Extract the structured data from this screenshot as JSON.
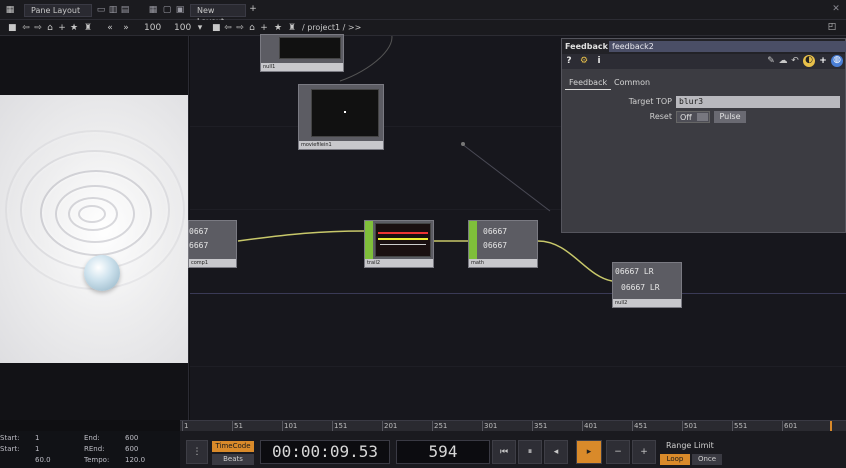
{
  "topbar": {
    "pane_layout_tab": "Pane Layout",
    "new_layout_tab": "New Layout",
    "close_glyph": "✕",
    "plus_glyph": "+"
  },
  "navbar": {
    "path": "/ project1 / >>",
    "zoom_left": "100",
    "zoom_right": "100"
  },
  "panel": {
    "op_type": "Feedback",
    "op_name": "feedback2",
    "help_glyph": "?",
    "info_glyph": "i",
    "tabs": [
      "Feedback",
      "Common"
    ],
    "params": {
      "target_top_label": "Target TOP",
      "target_top_value": "blur3",
      "reset_label": "Reset",
      "reset_value": "Off",
      "pulse_label": "Pulse"
    }
  },
  "nodes": {
    "top_small_label": "null1",
    "mid_label": "moviefilein1",
    "left_node_text": [
      "0667",
      "6667"
    ],
    "left_node_label": "comp1",
    "scope_label": "trail2",
    "num_node_text": [
      "06667",
      "06667"
    ],
    "num_node_label": "math",
    "right_node_text": [
      "06667 LR",
      "06667 LR"
    ],
    "right_node_label": "null2"
  },
  "timeline": {
    "ticks": [
      "1",
      "51",
      "101",
      "151",
      "201",
      "251",
      "301",
      "351",
      "401",
      "451",
      "501",
      "551",
      "601"
    ],
    "timecode": "00:00:09.53",
    "frame": "594",
    "timecode_btn": "TimeCode",
    "beats_btn": "Beats",
    "range_limit_label": "Range Limit",
    "loop_btn": "Loop",
    "once_btn": "Once"
  },
  "bottom_left": {
    "start_label": "Start:",
    "start_value": "1",
    "end_label": "End:",
    "end_value": "600",
    "rstart_label": "Start:",
    "rstart_value": "1",
    "rend_label": "REnd:",
    "rend_value": "600",
    "fps_value": "60.0",
    "tempo_label": "Tempo:",
    "tempo_value": "120.0"
  },
  "colors": {
    "accent_orange": "#d98a2a",
    "node_green": "#7fbf3a",
    "wire_yellow": "#c8c86a",
    "panel_bg": "#3c3c42"
  }
}
